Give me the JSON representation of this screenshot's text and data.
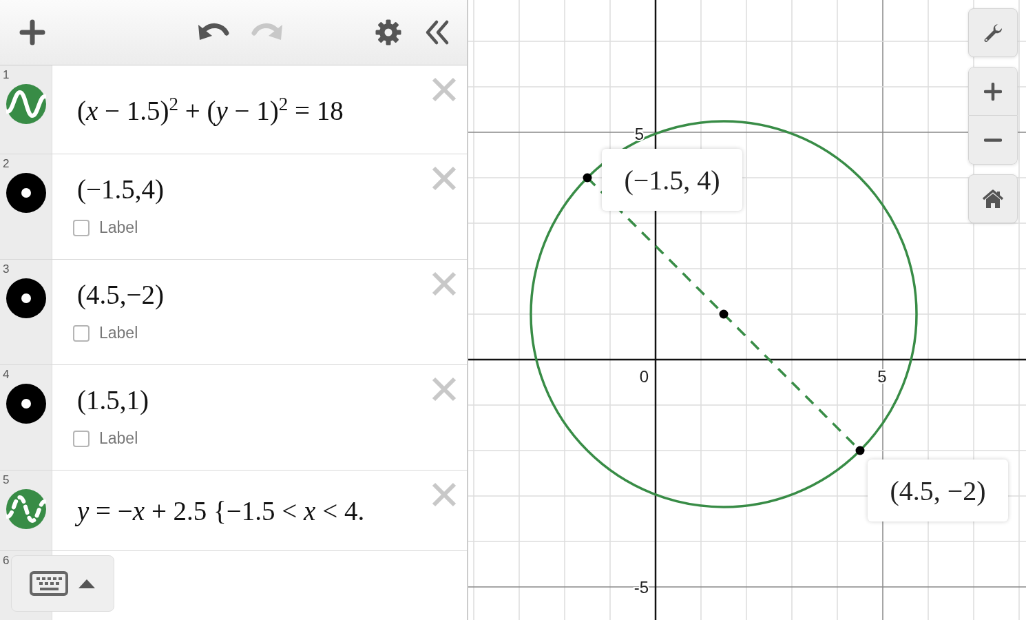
{
  "toolbar": {
    "undo": {
      "disabled": false
    },
    "redo": {
      "disabled": true
    }
  },
  "expressions": [
    {
      "number": "1",
      "kind": "solid",
      "latex": "(*x* − 1.5)$^{2}$ + (*y* − 1)$^{2}$ = 18"
    },
    {
      "number": "2",
      "kind": "point",
      "latex": "(−1.5,4)",
      "label_text": "Label",
      "label_checked": false
    },
    {
      "number": "3",
      "kind": "point",
      "latex": "(4.5,−2)",
      "label_text": "Label",
      "label_checked": false
    },
    {
      "number": "4",
      "kind": "point",
      "latex": "(1.5,1)",
      "label_text": "Label",
      "label_checked": false
    },
    {
      "number": "5",
      "kind": "dashed",
      "latex": "*y* = −*x* + 2.5 {−1.5 < *x* < 4."
    },
    {
      "number": "6",
      "kind": "empty"
    }
  ],
  "graph": {
    "axis_labels": [
      "5",
      "0",
      "5",
      "-5"
    ],
    "point_labels": [
      "(−1.5, 4)",
      "(4.5, −2)"
    ]
  }
}
